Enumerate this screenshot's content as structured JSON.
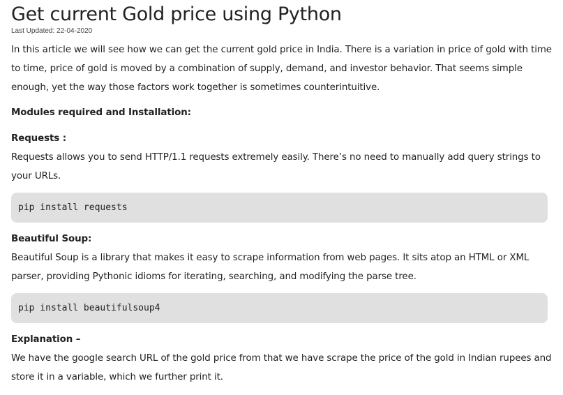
{
  "article": {
    "title": "Get current Gold price using Python",
    "last_updated": "Last Updated: 22-04-2020",
    "intro": "In this article we will see how we can get the current gold price in India. There is a variation in price of gold with time to time, price of gold is moved by a combination of supply, demand, and investor behavior. That seems simple enough, yet the way those factors work together is sometimes counterintuitive.",
    "modules_heading": "Modules required and Installation:",
    "requests": {
      "heading": "Requests :",
      "description": "Requests allows you to send HTTP/1.1 requests extremely easily. There’s no need to manually add query strings to your URLs.",
      "install_command": "pip install requests"
    },
    "beautiful_soup": {
      "heading": "Beautiful Soup:",
      "description": "Beautiful Soup is a library that makes it easy to scrape information from web pages. It sits atop an HTML or XML parser, providing Pythonic idioms for iterating, searching, and modifying the parse tree.",
      "install_command": "pip install beautifulsoup4"
    },
    "explanation": {
      "heading": "Explanation –",
      "text": "We have the google search URL of the gold price from that we have scrape the price of the gold in Indian rupees and store it in a variable, which we further print it."
    }
  }
}
